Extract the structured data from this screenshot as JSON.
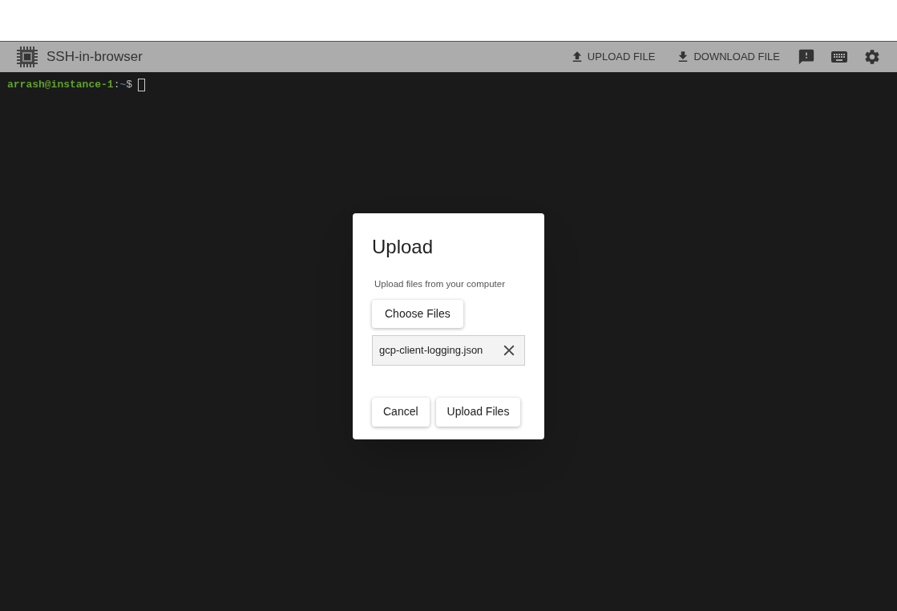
{
  "toolbar": {
    "title": "SSH-in-browser",
    "actions": [
      {
        "kind": "upload",
        "label": "UPLOAD FILE"
      },
      {
        "kind": "download",
        "label": "DOWNLOAD FILE"
      },
      {
        "kind": "feedback"
      },
      {
        "kind": "keyboard"
      },
      {
        "kind": "settings"
      }
    ]
  },
  "terminal": {
    "prompt": {
      "user_host": "arrash@instance-1",
      "separator": ":",
      "path": "~",
      "symbol": "$"
    }
  },
  "dialog": {
    "title": "Upload",
    "description": "Upload files from your computer",
    "choose_button": "Choose Files",
    "files": [
      {
        "name": "gcp-client-logging.json"
      }
    ],
    "buttons": [
      "Cancel",
      "Upload Files"
    ]
  }
}
